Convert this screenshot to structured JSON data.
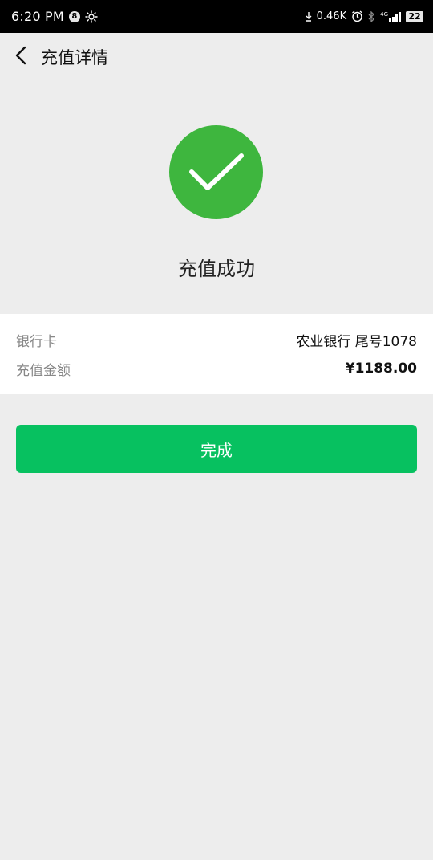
{
  "status_bar": {
    "time": "6:20 PM",
    "notification_badge": "8",
    "network_speed": "0.46K",
    "network_type": "4G",
    "battery": "22"
  },
  "nav": {
    "title": "充值详情",
    "back_icon": "chevron-left-icon"
  },
  "result": {
    "icon": "check-circle-icon",
    "icon_color": "#3eb63e",
    "title": "充值成功"
  },
  "details": {
    "rows": [
      {
        "label": "银行卡",
        "value": "农业银行 尾号1078"
      },
      {
        "label": "充值金额",
        "value": "¥1188.00"
      }
    ]
  },
  "actions": {
    "done_label": "完成",
    "done_color": "#07c160"
  }
}
